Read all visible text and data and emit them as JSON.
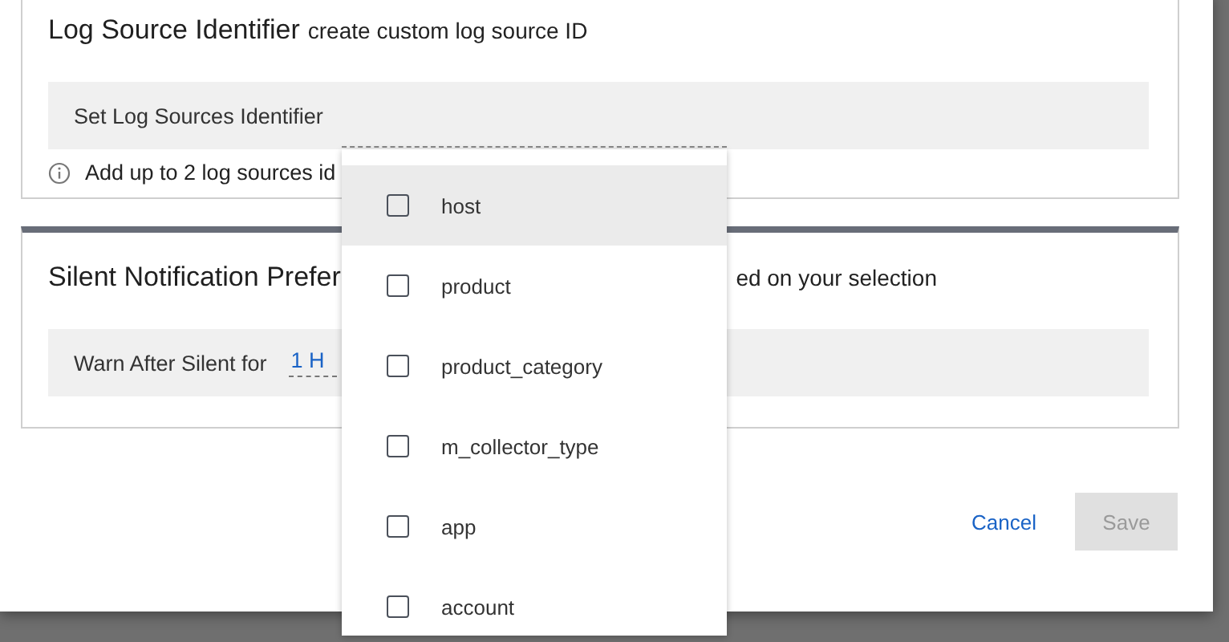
{
  "log_source_panel": {
    "title": "Log Source Identifier",
    "subtitle": "create custom log source ID",
    "field": {
      "placeholder": "Set Log Sources Identifier"
    },
    "hint": "Add up to 2 log sources id"
  },
  "silent_panel": {
    "title": "Silent Notification Prefer",
    "title_tail": "ed on your selection",
    "field_label": "Warn After Silent for",
    "field_value": "1 H"
  },
  "dropdown": {
    "items": [
      {
        "label": "host",
        "checked": false,
        "highlighted": true
      },
      {
        "label": "product",
        "checked": false,
        "highlighted": false
      },
      {
        "label": "product_category",
        "checked": false,
        "highlighted": false
      },
      {
        "label": "m_collector_type",
        "checked": false,
        "highlighted": false
      },
      {
        "label": "app",
        "checked": false,
        "highlighted": false
      },
      {
        "label": "account",
        "checked": false,
        "highlighted": false
      }
    ]
  },
  "buttons": [
    {
      "label": "Cancel",
      "kind": "link",
      "disabled": false
    },
    {
      "label": "Save",
      "kind": "primary",
      "disabled": true
    }
  ]
}
